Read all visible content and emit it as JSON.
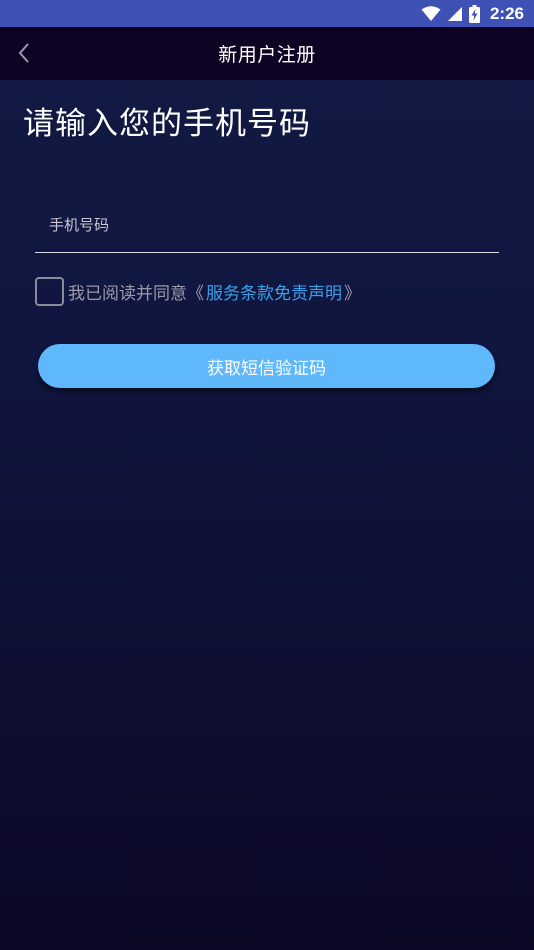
{
  "status_bar": {
    "time": "2:26",
    "icons": [
      "wifi-icon",
      "cell-signal-icon",
      "battery-charging-icon"
    ]
  },
  "app_bar": {
    "title": "新用户注册",
    "back_icon": "chevron-left-icon"
  },
  "form": {
    "heading": "请输入您的手机号码",
    "phone_placeholder": "手机号码",
    "phone_value": "",
    "agree_checked": false,
    "agree_text": "我已阅读并同意",
    "terms_open_bracket": "《",
    "terms_link": "服务条款免责声明",
    "terms_close_bracket": "》",
    "submit_label": "获取短信验证码"
  },
  "colors": {
    "status_bar": "#3f51b5",
    "app_bar": "#0d0424",
    "background_top": "#121b45",
    "background_bottom": "#0c0826",
    "link": "#3aa0e8",
    "button": "#5fb8fb"
  }
}
